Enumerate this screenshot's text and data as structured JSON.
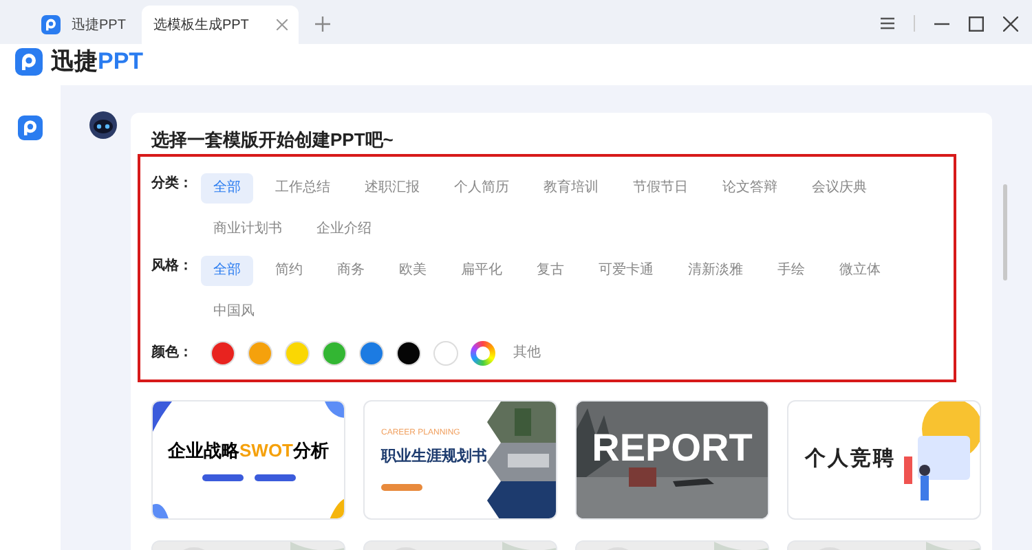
{
  "tabs": [
    {
      "kind": "app",
      "label": "迅捷PPT",
      "selected": false
    },
    {
      "kind": "page",
      "label": "选模板生成PPT",
      "selected": true
    }
  ],
  "brand": {
    "name": "迅捷",
    "accent": "PPT"
  },
  "prompt": "选择一套模版开始创建PPT吧~",
  "filters": [
    {
      "label": "分类：",
      "options": [
        {
          "label": "全部",
          "selected": true
        },
        {
          "label": "工作总结",
          "selected": false
        },
        {
          "label": "述职汇报",
          "selected": false
        },
        {
          "label": "个人简历",
          "selected": false
        },
        {
          "label": "教育培训",
          "selected": false
        },
        {
          "label": "节假节日",
          "selected": false
        },
        {
          "label": "论文答辩",
          "selected": false
        },
        {
          "label": "会议庆典",
          "selected": false
        },
        {
          "label": "商业计划书",
          "selected": false
        },
        {
          "label": "企业介绍",
          "selected": false
        }
      ]
    },
    {
      "label": "风格：",
      "options": [
        {
          "label": "全部",
          "selected": true
        },
        {
          "label": "简约",
          "selected": false
        },
        {
          "label": "商务",
          "selected": false
        },
        {
          "label": "欧美",
          "selected": false
        },
        {
          "label": "扁平化",
          "selected": false
        },
        {
          "label": "复古",
          "selected": false
        },
        {
          "label": "可爱卡通",
          "selected": false
        },
        {
          "label": "清新淡雅",
          "selected": false
        },
        {
          "label": "手绘",
          "selected": false
        },
        {
          "label": "微立体",
          "selected": false
        },
        {
          "label": "中国风",
          "selected": false
        }
      ]
    }
  ],
  "colors": {
    "label": "颜色：",
    "swatches": [
      {
        "kind": "solid",
        "color": "#e8231f"
      },
      {
        "kind": "solid",
        "color": "#f5a10c"
      },
      {
        "kind": "solid",
        "color": "#fad703"
      },
      {
        "kind": "solid",
        "color": "#33b633"
      },
      {
        "kind": "solid",
        "color": "#1c7be2"
      },
      {
        "kind": "solid",
        "color": "#050505"
      },
      {
        "kind": "solid",
        "color": "#ffffff"
      },
      {
        "kind": "rainbow"
      }
    ],
    "other": "其他"
  },
  "templates": [
    {
      "kind": "swot",
      "title": "企业战略",
      "highlight": "SWOT",
      "suffix": "分析"
    },
    {
      "kind": "career",
      "subtitle": "CAREER PLANNING",
      "title": "职业生涯规划书"
    },
    {
      "kind": "report",
      "title": "REPORT"
    },
    {
      "kind": "compete",
      "title": "个人竞聘"
    },
    {
      "kind": "picture"
    },
    {
      "kind": "picture"
    },
    {
      "kind": "picture"
    },
    {
      "kind": "picture"
    }
  ]
}
